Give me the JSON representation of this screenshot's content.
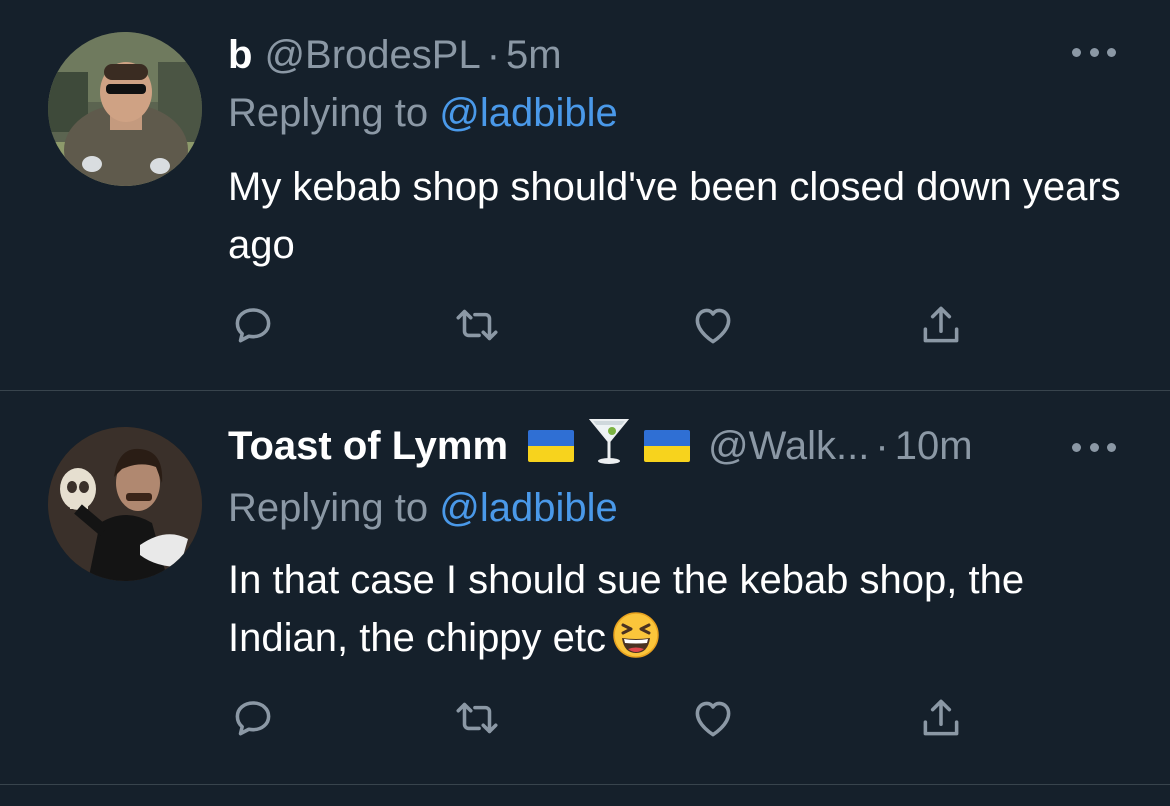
{
  "tweets": [
    {
      "display_name": "b",
      "handle": "@BrodesPL",
      "separator": "·",
      "time": "5m",
      "replying_prefix": "Replying to ",
      "replying_to": "@ladbible",
      "text": "My kebab shop should've been closed down years ago",
      "avatar_icon": "profile-photo",
      "actions": [
        "reply-icon",
        "retweet-icon",
        "like-icon",
        "share-icon"
      ]
    },
    {
      "display_name": "Toast of Lymm",
      "name_emoji": [
        "ukraine-flag",
        "cocktail-glass",
        "ukraine-flag"
      ],
      "handle": "@Walk...",
      "separator": "·",
      "time": "10m",
      "replying_prefix": "Replying to ",
      "replying_to": "@ladbible",
      "text": "In that case I should sue the kebab shop, the Indian, the chippy etc",
      "text_emoji": "grinning-squinting-face",
      "avatar_icon": "profile-photo",
      "actions": [
        "reply-icon",
        "retweet-icon",
        "like-icon",
        "share-icon"
      ]
    }
  ],
  "colors": {
    "background": "#15202b",
    "text_primary": "#ffffff",
    "text_secondary": "#8b98a5",
    "link": "#4a99e9",
    "divider": "#38444d"
  }
}
